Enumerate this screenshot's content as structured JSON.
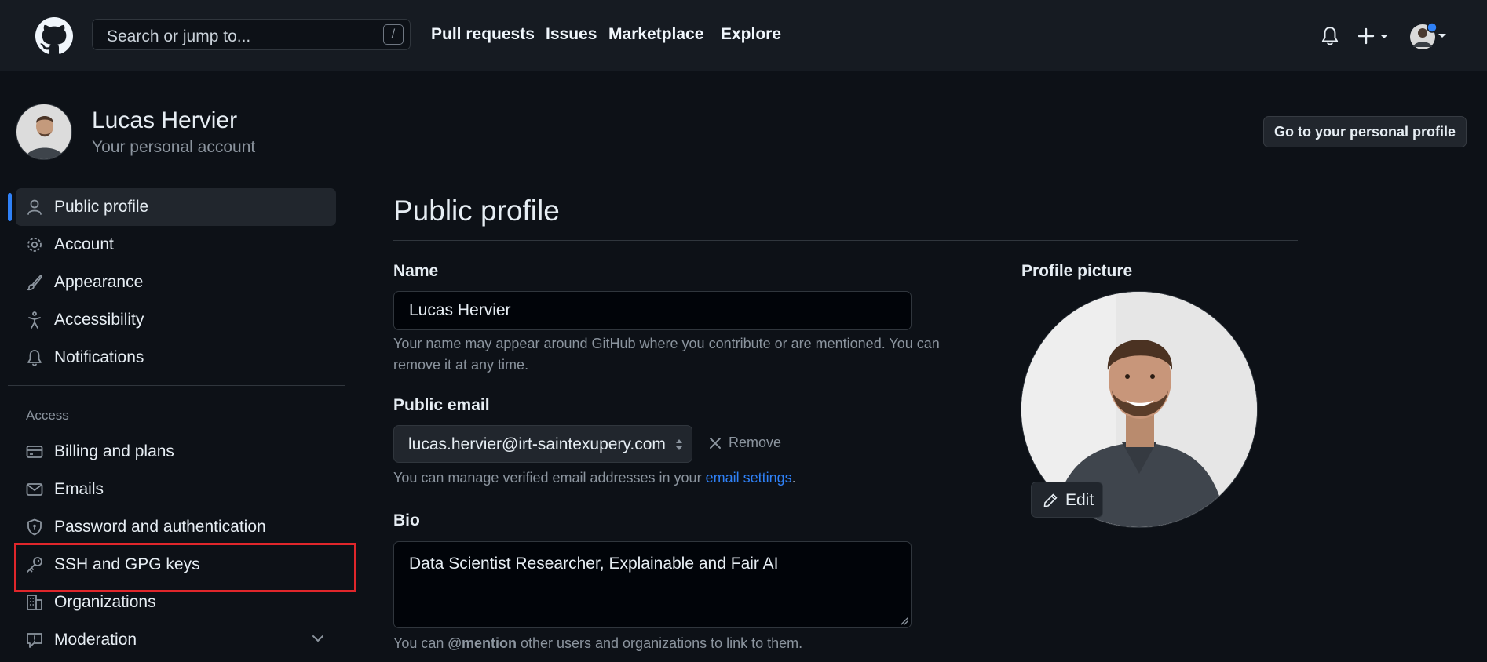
{
  "header": {
    "logo": "github-logo-icon",
    "search_placeholder": "Search or jump to...",
    "search_key": "/",
    "nav": [
      "Pull requests",
      "Issues",
      "Marketplace",
      "Explore"
    ],
    "icons": [
      "bell-icon",
      "plus-icon",
      "avatar"
    ]
  },
  "user": {
    "name": "Lucas Hervier",
    "subtitle": "Your personal account",
    "profile_button": "Go to your personal profile"
  },
  "sidebar": {
    "items": [
      {
        "label": "Public profile",
        "icon": "person-icon",
        "active": true
      },
      {
        "label": "Account",
        "icon": "gear-icon"
      },
      {
        "label": "Appearance",
        "icon": "paintbrush-icon"
      },
      {
        "label": "Accessibility",
        "icon": "accessibility-icon"
      },
      {
        "label": "Notifications",
        "icon": "bell-icon"
      }
    ],
    "access_heading": "Access",
    "access_items": [
      {
        "label": "Billing and plans",
        "icon": "credit-card-icon"
      },
      {
        "label": "Emails",
        "icon": "mail-icon"
      },
      {
        "label": "Password and authentication",
        "icon": "shield-lock-icon"
      },
      {
        "label": "SSH and GPG keys",
        "icon": "key-icon",
        "highlighted": true
      },
      {
        "label": "Organizations",
        "icon": "organization-icon"
      },
      {
        "label": "Moderation",
        "icon": "report-icon",
        "expandable": true
      }
    ]
  },
  "main": {
    "title": "Public profile",
    "name_label": "Name",
    "name_value": "Lucas Hervier",
    "name_help": "Your name may appear around GitHub where you contribute or are mentioned. You can remove it at any time.",
    "email_label": "Public email",
    "email_value": "lucas.hervier@irt-saintexupery.com",
    "remove_label": "Remove",
    "email_help_prefix": "You can manage verified email addresses in your ",
    "email_help_link": "email settings",
    "email_help_suffix": ".",
    "bio_label": "Bio",
    "bio_value": "Data Scientist Researcher, Explainable and Fair AI",
    "bio_help_prefix": "You can ",
    "bio_help_mention": "@mention",
    "bio_help_suffix": " other users and organizations to link to them."
  },
  "profile_picture": {
    "label": "Profile picture",
    "edit_label": "Edit"
  },
  "colors": {
    "background": "#0d1117",
    "header": "#161b22",
    "accent": "#2f81f7",
    "highlight": "#e0262b"
  }
}
